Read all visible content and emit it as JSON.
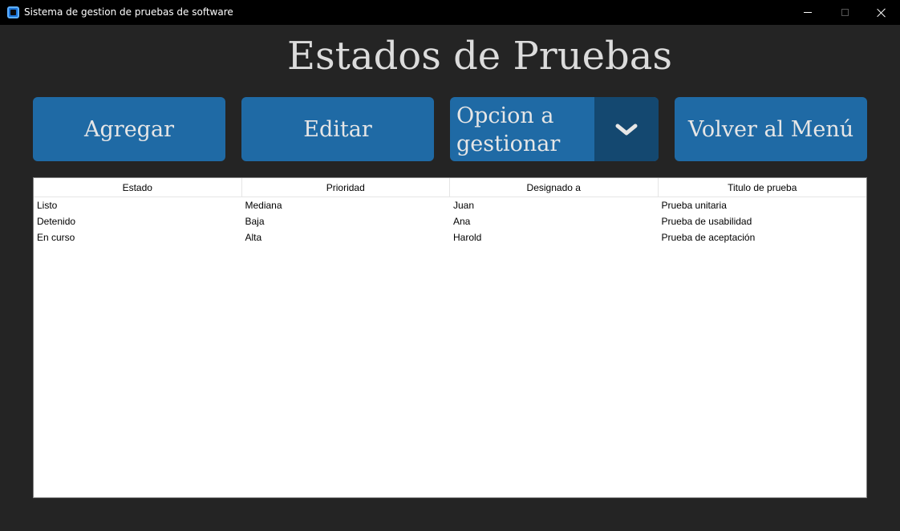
{
  "window": {
    "title": "Sistema de gestion de pruebas de software",
    "icon": "app-icon"
  },
  "heading": "Estados de Pruebas",
  "buttons": {
    "add_label": "Agregar",
    "edit_label": "Editar",
    "back_label": "Volver al Menú"
  },
  "combo": {
    "selected": "Opcion a gestionar",
    "arrow_icon": "chevron-down-icon"
  },
  "table": {
    "columns": [
      "Estado",
      "Prioridad",
      "Designado a",
      "Titulo de prueba"
    ],
    "rows": [
      [
        "Listo",
        "Mediana",
        "Juan",
        "Prueba unitaria"
      ],
      [
        "Detenido",
        "Baja",
        "Ana",
        "Prueba de usabilidad"
      ],
      [
        "En curso",
        "Alta",
        "Harold",
        "Prueba de aceptación"
      ]
    ]
  },
  "colors": {
    "background": "#242424",
    "titlebar": "#000000",
    "button": "#1f6aa5",
    "combo_arrow": "#144870",
    "heading_text": "#dcdcdc"
  }
}
